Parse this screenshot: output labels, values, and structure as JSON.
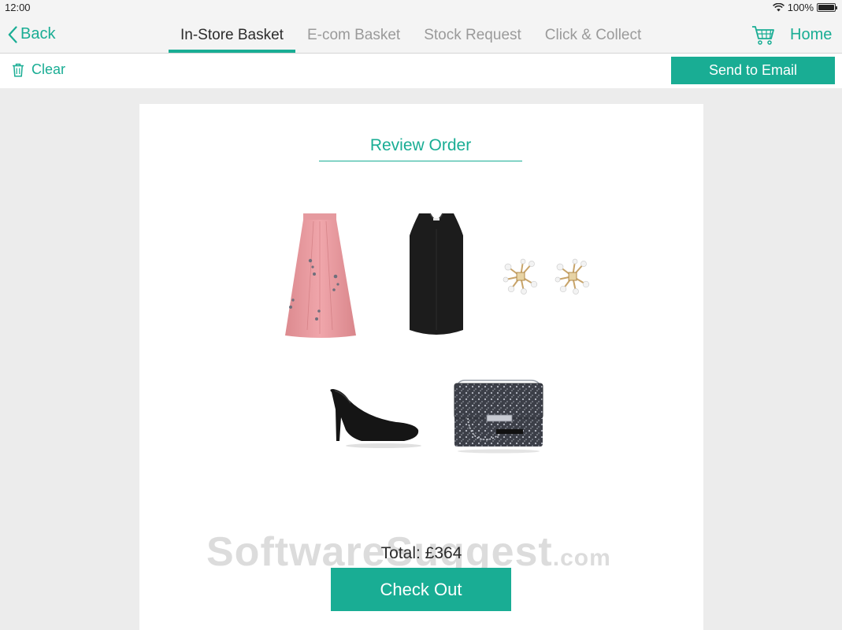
{
  "status_bar": {
    "time": "12:00",
    "battery": "100%",
    "battery_level": 1.0
  },
  "nav": {
    "back_label": "Back",
    "tabs": [
      {
        "label": "In-Store Basket",
        "active": true
      },
      {
        "label": "E-com Basket",
        "active": false
      },
      {
        "label": "Stock Request",
        "active": false
      },
      {
        "label": "Click & Collect",
        "active": false
      }
    ],
    "cart_icon": "shopping-cart-icon",
    "home_label": "Home"
  },
  "toolbar": {
    "clear_label": "Clear",
    "clear_icon": "trash-icon",
    "send_email_label": "Send to Email"
  },
  "order": {
    "title": "Review Order",
    "products": [
      {
        "image": "pink-maxi-skirt"
      },
      {
        "image": "black-sleeveless-top"
      },
      {
        "image": "pearl-cluster-earrings"
      },
      {
        "image": "black-suede-pump"
      },
      {
        "image": "glitter-chain-clutch-bag"
      }
    ],
    "total": "Total: £364",
    "checkout_label": "Check Out"
  },
  "watermark": {
    "main": "SoftwareSuggest",
    "suffix": ".com"
  },
  "colors": {
    "accent": "#19ad94",
    "background": "#ececec",
    "card": "#ffffff",
    "inactive_tab": "#9a9a9a"
  }
}
